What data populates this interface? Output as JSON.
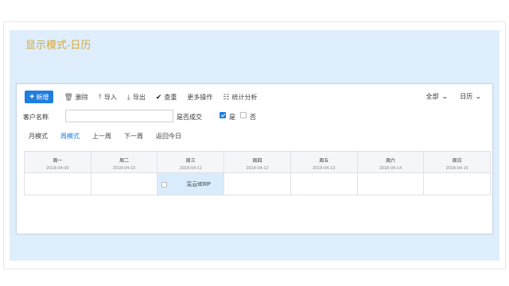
{
  "page": {
    "title": "显示模式-日历"
  },
  "toolbar": {
    "new_label": "新增",
    "delete_label": "删除",
    "import_label": "导入",
    "export_label": "导出",
    "query_label": "查重",
    "more_label": "更多操作",
    "stats_label": "统计分析"
  },
  "right_tools": {
    "filter_label": "全部",
    "view_label": "日历"
  },
  "filters": {
    "customer_name_label": "客户名称",
    "customer_name_value": "",
    "deal_label": "是否成交",
    "yes_label": "是",
    "yes_checked": true,
    "no_label": "否",
    "no_checked": false
  },
  "modes": {
    "month": "月模式",
    "week": "周模式",
    "prev_week": "上一周",
    "next_week": "下一周",
    "today": "返回今日",
    "active": "week"
  },
  "calendar": {
    "days": [
      {
        "name": "周一",
        "date": "2018-04-09"
      },
      {
        "name": "周二",
        "date": "2018-04-10"
      },
      {
        "name": "周三",
        "date": "2018-04-11"
      },
      {
        "name": "周四",
        "date": "2018-04-12"
      },
      {
        "name": "周五",
        "date": "2018-04-13"
      },
      {
        "name": "周六",
        "date": "2018-04-14"
      },
      {
        "name": "周日",
        "date": "2018-04-15"
      }
    ],
    "event": {
      "day_index": 2,
      "label": "氚云tERP"
    }
  },
  "colors": {
    "primary": "#1e7ee0",
    "panel_bg": "#deeefc",
    "title": "#d4a843",
    "event_bg": "#d9ecfd"
  },
  "icons": {
    "delete": "trash-icon",
    "import": "upload-icon",
    "export": "download-icon",
    "query": "check-icon",
    "stats": "chart-icon"
  }
}
